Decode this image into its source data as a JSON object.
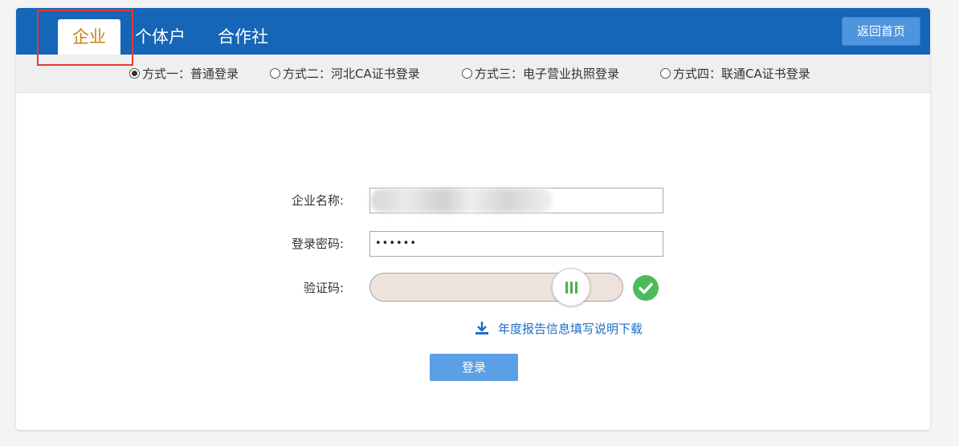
{
  "tabs": [
    {
      "label": "企业",
      "active": true
    },
    {
      "label": "个体户",
      "active": false
    },
    {
      "label": "合作社",
      "active": false
    }
  ],
  "home_button": "返回首页",
  "login_methods": [
    {
      "label": "方式一：普通登录",
      "selected": true
    },
    {
      "label": "方式二：河北CA证书登录",
      "selected": false
    },
    {
      "label": "方式三：电子营业执照登录",
      "selected": false
    },
    {
      "label": "方式四：联通CA证书登录",
      "selected": false
    }
  ],
  "form": {
    "company_name_label": "企业名称:",
    "password_label": "登录密码:",
    "password_value": "••••••",
    "captcha_label": "验证码:",
    "captcha_verified": true,
    "download_link": "年度报告信息填写说明下载",
    "login_button": "登录"
  },
  "colors": {
    "header_blue": "#1565b8",
    "active_tab_text": "#c8811a",
    "highlight_red": "#e53935",
    "success_green": "#4cbb5b",
    "link_blue": "#1a6ec9"
  }
}
